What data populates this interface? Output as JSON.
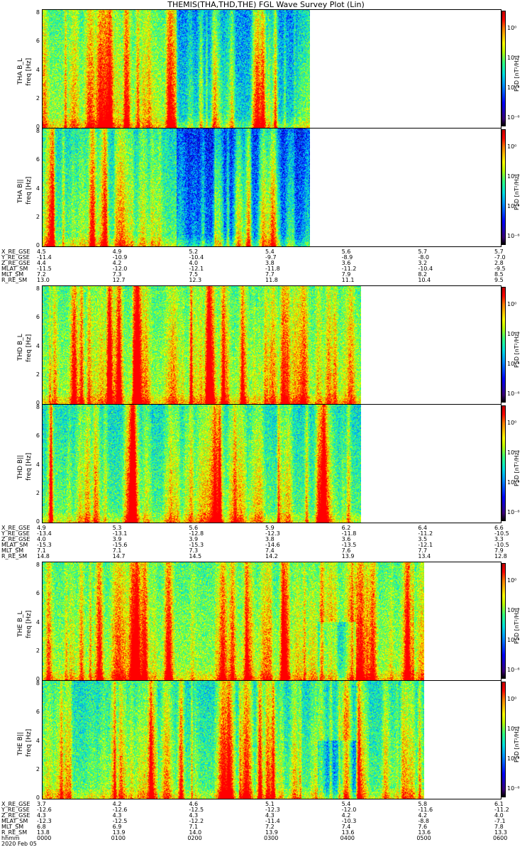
{
  "title": "THEMIS(THA,THD,THE) FGL Wave Survey Plot (Lin)",
  "colorbar_label": "PSD [nT²/Hz]",
  "ylabel_suffix": "freq [Hz]",
  "y_ticks": [
    "0",
    "2",
    "4",
    "6",
    "8"
  ],
  "cbar_ticks": [
    "10⁰",
    "10⁻²",
    "10⁻⁴",
    "10⁻⁶"
  ],
  "date_label": "2020 Feb 05",
  "chart_data": {
    "type": "heatmap",
    "x_axis": {
      "label": "hhmm",
      "ticks": [
        "0000",
        "0100",
        "0200",
        "0300",
        "0400",
        "0500",
        "0600"
      ]
    },
    "y_axis": {
      "label": "freq [Hz]",
      "range": [
        0,
        8
      ]
    },
    "color_scale": {
      "type": "log",
      "label": "PSD [nT²/Hz]",
      "ticks": [
        "10⁰",
        "10⁻²",
        "10⁻⁴",
        "10⁻⁶"
      ]
    },
    "groups": [
      {
        "probe": "THA",
        "panels": [
          {
            "label": "THA B_L",
            "data_end_hhmm": "0330"
          },
          {
            "label": "THA B||",
            "data_end_hhmm": "0330"
          }
        ],
        "ephemeris": [
          {
            "name": "X_RE_GSE",
            "values": [
              "4.5",
              "4.9",
              "5.2",
              "5.4",
              "5.6",
              "5.7",
              "5.7"
            ]
          },
          {
            "name": "Y_RE_GSE",
            "values": [
              "-11.4",
              "-10.9",
              "-10.4",
              "-9.7",
              "-8.9",
              "-8.0",
              "-7.0"
            ]
          },
          {
            "name": "Z_RE_GSE",
            "values": [
              "4.4",
              "4.2",
              "4.0",
              "3.8",
              "3.6",
              "3.2",
              "2.8"
            ]
          },
          {
            "name": "MLAT_SM",
            "values": [
              "-11.5",
              "-12.0",
              "-12.1",
              "-11.8",
              "-11.2",
              "-10.4",
              "-9.5"
            ]
          },
          {
            "name": "MLT_SM",
            "values": [
              "7.2",
              "7.3",
              "7.5",
              "7.7",
              "7.9",
              "8.2",
              "8.5"
            ]
          },
          {
            "name": "R_RE_SM",
            "values": [
              "13.0",
              "12.7",
              "12.3",
              "11.8",
              "11.1",
              "10.4",
              "9.5"
            ]
          }
        ]
      },
      {
        "probe": "THD",
        "panels": [
          {
            "label": "THD B_L",
            "data_end_hhmm": "0410"
          },
          {
            "label": "THD B||",
            "data_end_hhmm": "0410"
          }
        ],
        "ephemeris": [
          {
            "name": "X_RE_GSE",
            "values": [
              "4.9",
              "5.3",
              "5.6",
              "5.9",
              "6.2",
              "6.4",
              "6.6"
            ]
          },
          {
            "name": "Y_RE_GSE",
            "values": [
              "-13.4",
              "-13.1",
              "-12.8",
              "-12.3",
              "-11.8",
              "-11.2",
              "-10.5"
            ]
          },
          {
            "name": "Z_RE_GSE",
            "values": [
              "4.0",
              "3.9",
              "3.9",
              "3.8",
              "3.6",
              "3.5",
              "3.3"
            ]
          },
          {
            "name": "MLAT_SM",
            "values": [
              "-15.3",
              "-15.6",
              "-15.3",
              "-14.6",
              "-13.5",
              "-12.1",
              "-10.5"
            ]
          },
          {
            "name": "MLT_SM",
            "values": [
              "7.1",
              "7.1",
              "7.3",
              "7.4",
              "7.6",
              "7.7",
              "7.9"
            ]
          },
          {
            "name": "R_RE_SM",
            "values": [
              "14.8",
              "14.7",
              "14.5",
              "14.2",
              "13.9",
              "13.4",
              "12.8"
            ]
          }
        ]
      },
      {
        "probe": "THE",
        "panels": [
          {
            "label": "THE B_L",
            "data_end_hhmm": "0500"
          },
          {
            "label": "THE B||",
            "data_end_hhmm": "0500"
          }
        ],
        "ephemeris": [
          {
            "name": "X_RE_GSE",
            "values": [
              "3.7",
              "4.2",
              "4.6",
              "5.1",
              "5.4",
              "5.8",
              "6.1"
            ]
          },
          {
            "name": "Y_RE_GSE",
            "values": [
              "-12.6",
              "-12.6",
              "-12.5",
              "-12.3",
              "-12.0",
              "-11.6",
              "-11.2"
            ]
          },
          {
            "name": "Z_RE_GSE",
            "values": [
              "4.3",
              "4.3",
              "4.3",
              "4.3",
              "4.2",
              "4.2",
              "4.0"
            ]
          },
          {
            "name": "MLAT_SM",
            "values": [
              "-12.3",
              "-12.5",
              "-12.2",
              "-11.4",
              "-10.3",
              "-8.8",
              "-7.1"
            ]
          },
          {
            "name": "MLT_SM",
            "values": [
              "6.8",
              "6.9",
              "7.1",
              "7.2",
              "7.4",
              "7.6",
              "7.8"
            ]
          },
          {
            "name": "R_RE_SM",
            "values": [
              "13.8",
              "13.9",
              "14.0",
              "13.9",
              "13.6",
              "13.6",
              "13.3"
            ]
          }
        ]
      }
    ]
  }
}
